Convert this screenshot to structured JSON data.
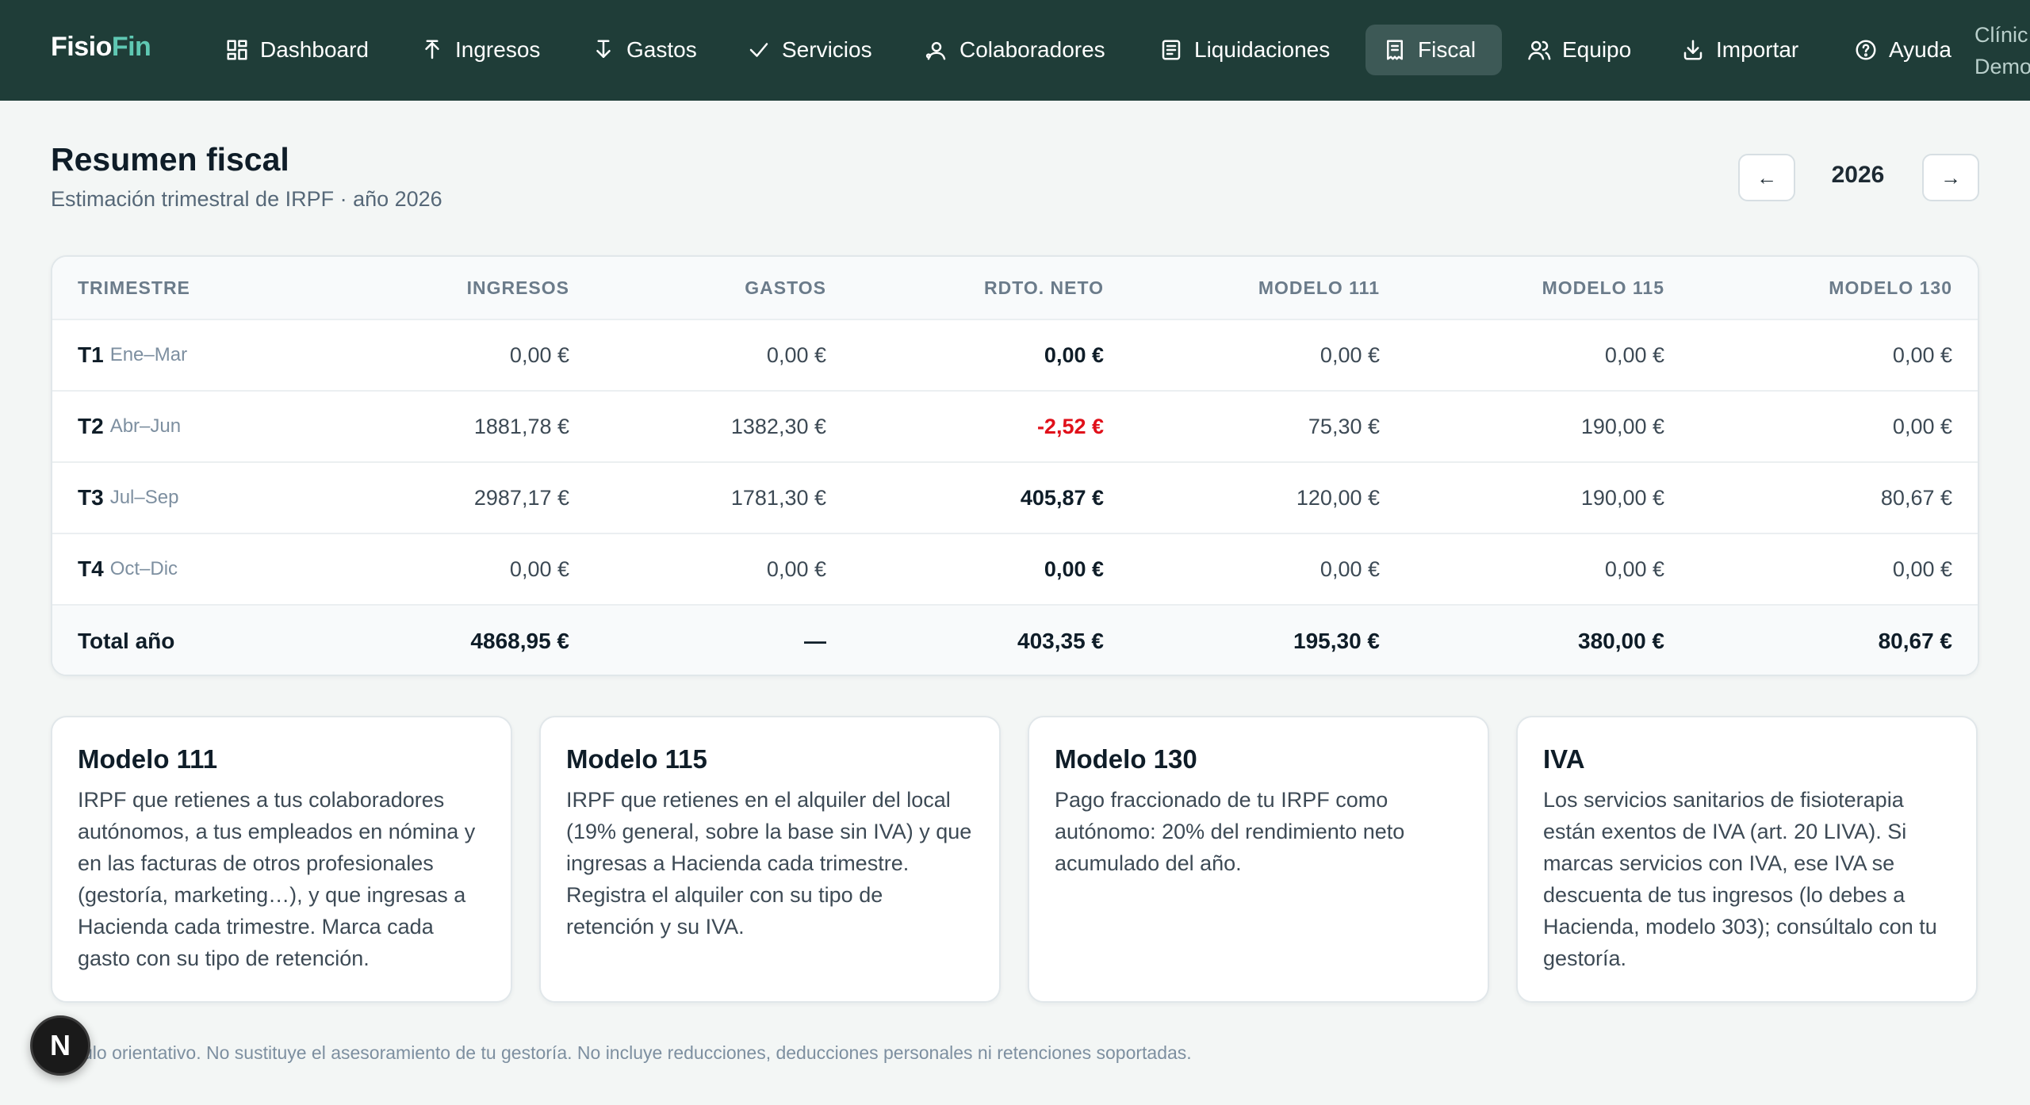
{
  "brand": {
    "part1": "Fisio",
    "part2": "Fin"
  },
  "nav": [
    {
      "label": "Dashboard",
      "icon": "dashboard-icon",
      "active": false
    },
    {
      "label": "Ingresos",
      "icon": "upload-arrow-icon",
      "active": false
    },
    {
      "label": "Gastos",
      "icon": "download-bar-icon",
      "active": false
    },
    {
      "label": "Servicios",
      "icon": "check-icon",
      "active": false
    },
    {
      "label": "Colaboradores",
      "icon": "user-icon",
      "active": false
    },
    {
      "label": "Liquidaciones",
      "icon": "document-icon",
      "active": false
    },
    {
      "label": "Fiscal",
      "icon": "receipt-icon",
      "active": true
    },
    {
      "label": "Equipo",
      "icon": "team-icon",
      "active": false
    },
    {
      "label": "Importar",
      "icon": "import-icon",
      "active": false
    },
    {
      "label": "Ayuda",
      "icon": "help-icon",
      "active": false
    }
  ],
  "clinic": {
    "line1": "Clínic",
    "line2": "Demo"
  },
  "header": {
    "title": "Resumen fiscal",
    "subtitle": "Estimación trimestral de IRPF · año 2026",
    "year": "2026",
    "prev_label": "←",
    "next_label": "→"
  },
  "table": {
    "columns": [
      "TRIMESTRE",
      "INGRESOS",
      "GASTOS",
      "RDTO. NETO",
      "MODELO 111",
      "MODELO 115",
      "MODELO 130"
    ],
    "rows": [
      {
        "q": "T1",
        "range": "Ene–Mar",
        "ingresos": "0,00 €",
        "gastos": "0,00 €",
        "neto": "0,00 €",
        "m111": "0,00 €",
        "m115": "0,00 €",
        "m130": "0,00 €"
      },
      {
        "q": "T2",
        "range": "Abr–Jun",
        "ingresos": "1881,78 €",
        "gastos": "1382,30 €",
        "neto": "-2,52 €",
        "m111": "75,30 €",
        "m115": "190,00 €",
        "m130": "0,00 €"
      },
      {
        "q": "T3",
        "range": "Jul–Sep",
        "ingresos": "2987,17 €",
        "gastos": "1781,30 €",
        "neto": "405,87 €",
        "m111": "120,00 €",
        "m115": "190,00 €",
        "m130": "80,67 €"
      },
      {
        "q": "T4",
        "range": "Oct–Dic",
        "ingresos": "0,00 €",
        "gastos": "0,00 €",
        "neto": "0,00 €",
        "m111": "0,00 €",
        "m115": "0,00 €",
        "m130": "0,00 €"
      }
    ],
    "total": {
      "label": "Total año",
      "ingresos": "4868,95 €",
      "gastos": "—",
      "neto": "403,35 €",
      "m111": "195,30 €",
      "m115": "380,00 €",
      "m130": "80,67 €"
    }
  },
  "cards": [
    {
      "title": "Modelo 111",
      "body": "IRPF que retienes a tus colaboradores autónomos, a tus empleados en nómina y en las facturas de otros profesionales (gestoría, marketing…), y que ingresas a Hacienda cada trimestre. Marca cada gasto con su tipo de retención."
    },
    {
      "title": "Modelo 115",
      "body": "IRPF que retienes en el alquiler del local (19% general, sobre la base sin IVA) y que ingresas a Hacienda cada trimestre. Registra el alquiler con su tipo de retención y su IVA."
    },
    {
      "title": "Modelo 130",
      "body": "Pago fraccionado de tu IRPF como autónomo: 20% del rendimiento neto acumulado del año."
    },
    {
      "title": "IVA",
      "body": "Los servicios sanitarios de fisioterapia están exentos de IVA (art. 20 LIVA). Si marcas servicios con IVA, ese IVA se descuenta de tus ingresos (lo debes a Hacienda, modelo 303); consúltalo con tu gestoría."
    }
  ],
  "footnote": "ulo orientativo. No sustituye el asesoramiento de tu gestoría. No incluye reducciones, deducciones personales ni retenciones soportadas.",
  "dev_badge": "N",
  "colors": {
    "nav_bg": "#1f3d38",
    "brand_accent": "#5fc8b3",
    "negative": "#e0101a"
  }
}
